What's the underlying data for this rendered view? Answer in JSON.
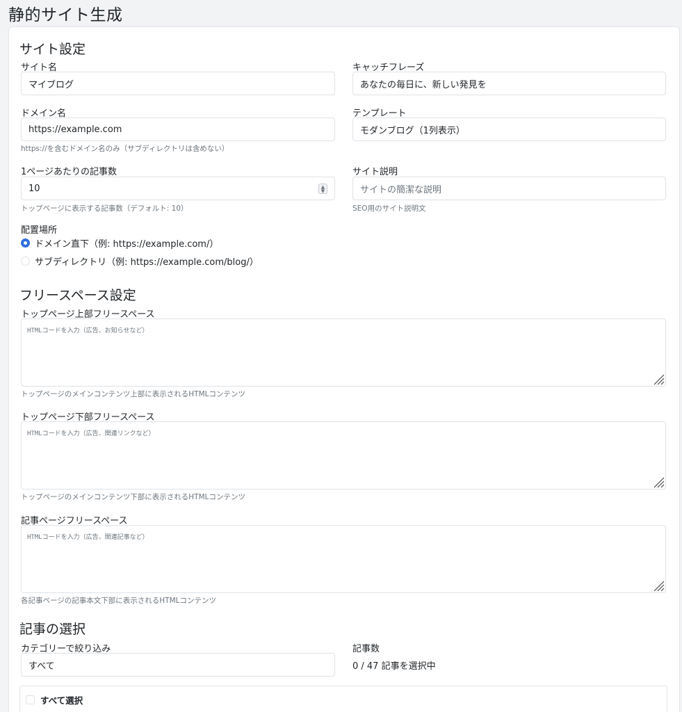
{
  "page": {
    "title": "静的サイト生成"
  },
  "site_settings": {
    "heading": "サイト設定",
    "site_name": {
      "label": "サイト名",
      "value": "マイブログ"
    },
    "catchphrase": {
      "label": "キャッチフレーズ",
      "value": "あなたの毎日に、新しい発見を"
    },
    "domain": {
      "label": "ドメイン名",
      "value": "https://example.com",
      "help": "https://を含むドメイン名のみ（サブディレクトリは含めない）"
    },
    "template": {
      "label": "テンプレート",
      "value": "モダンブログ（1列表示）"
    },
    "per_page": {
      "label": "1ページあたりの記事数",
      "value": "10",
      "help": "トップページに表示する記事数（デフォルト: 10）"
    },
    "description": {
      "label": "サイト説明",
      "placeholder": "サイトの簡潔な説明",
      "help": "SEO用のサイト説明文"
    },
    "placement": {
      "label": "配置場所",
      "options": [
        {
          "label": "ドメイン直下（例: https://example.com/）",
          "checked": true
        },
        {
          "label": "サブディレクトリ（例: https://example.com/blog/）",
          "checked": false
        }
      ]
    }
  },
  "free_space": {
    "heading": "フリースペース設定",
    "top_upper": {
      "label": "トップページ上部フリースペース",
      "placeholder": "HTMLコードを入力（広告、お知らせなど）",
      "help": "トップページのメインコンテンツ上部に表示されるHTMLコンテンツ"
    },
    "top_lower": {
      "label": "トップページ下部フリースペース",
      "placeholder": "HTMLコードを入力（広告、関連リンクなど）",
      "help": "トップページのメインコンテンツ下部に表示されるHTMLコンテンツ"
    },
    "article": {
      "label": "記事ページフリースペース",
      "placeholder": "HTMLコードを入力（広告、関連記事など）",
      "help": "各記事ページの記事本文下部に表示されるHTMLコンテンツ"
    }
  },
  "article_selection": {
    "heading": "記事の選択",
    "category": {
      "label": "カテゴリーで絞り込み",
      "value": "すべて"
    },
    "count": {
      "label": "記事数",
      "value": "0 / 47 記事を選択中"
    },
    "select_all": {
      "label": "すべて選択"
    }
  },
  "colors": {
    "accent": "#2f6fdf",
    "border": "#dee2e6",
    "muted": "#6c757d"
  },
  "icons": {
    "resize_handle": "resize-handle-icon",
    "spinner": "number-spinner-icon"
  }
}
